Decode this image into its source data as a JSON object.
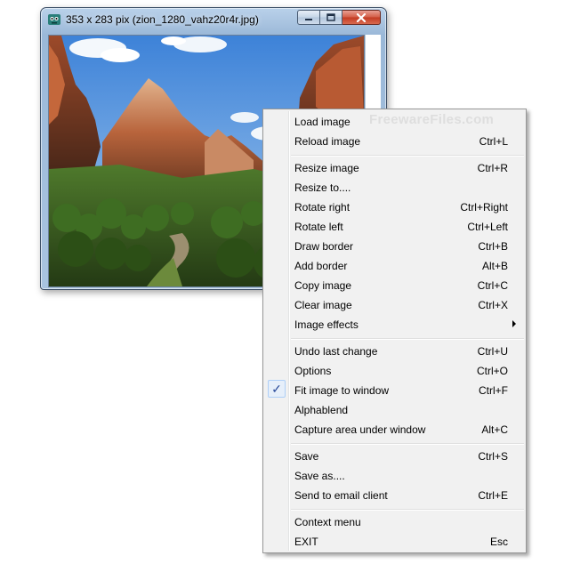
{
  "window": {
    "title": "353 x 283 pix (zion_1280_vahz20r4r.jpg)",
    "icon": "app-monkey-icon",
    "accent": "#a6c1de"
  },
  "menu": {
    "watermark": "FreewareFiles.com",
    "items": [
      {
        "label": "Load image",
        "shortcut": ""
      },
      {
        "label": "Reload image",
        "shortcut": "Ctrl+L"
      },
      {
        "label": "Resize image",
        "shortcut": "Ctrl+R"
      },
      {
        "label": "Resize to....",
        "shortcut": ""
      },
      {
        "label": "Rotate right",
        "shortcut": "Ctrl+Right"
      },
      {
        "label": "Rotate left",
        "shortcut": "Ctrl+Left"
      },
      {
        "label": "Draw border",
        "shortcut": "Ctrl+B"
      },
      {
        "label": "Add border",
        "shortcut": "Alt+B"
      },
      {
        "label": "Copy image",
        "shortcut": "Ctrl+C"
      },
      {
        "label": "Clear image",
        "shortcut": "Ctrl+X"
      },
      {
        "label": "Image effects",
        "shortcut": "",
        "submenu": true
      },
      {
        "label": "Undo last change",
        "shortcut": "Ctrl+U"
      },
      {
        "label": "Options",
        "shortcut": "Ctrl+O"
      },
      {
        "label": "Fit image to window",
        "shortcut": "Ctrl+F",
        "checked": true
      },
      {
        "label": "Alphablend",
        "shortcut": ""
      },
      {
        "label": "Capture area under window",
        "shortcut": "Alt+C"
      },
      {
        "label": "Save",
        "shortcut": "Ctrl+S"
      },
      {
        "label": "Save as....",
        "shortcut": ""
      },
      {
        "label": "Send to email client",
        "shortcut": "Ctrl+E"
      },
      {
        "label": "Context menu",
        "shortcut": ""
      },
      {
        "label": "EXIT",
        "shortcut": "Esc"
      }
    ]
  }
}
